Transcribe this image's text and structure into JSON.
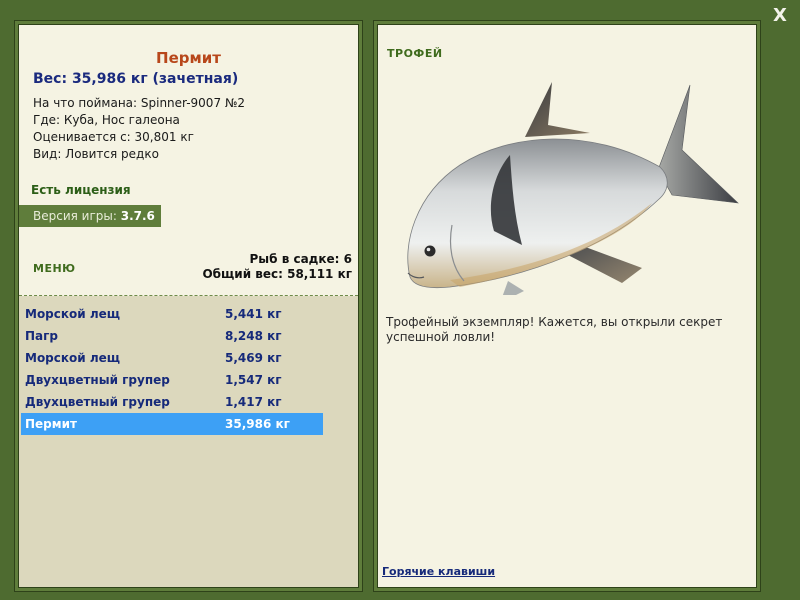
{
  "close_label": "X",
  "fish": {
    "title": "Пермит",
    "weight_line": "Вес: 35,986 кг (зачетная)",
    "info": [
      "На что поймана: Spinner-9007 №2",
      "Где: Куба, Нос галеона",
      "Оценивается с: 30,801 кг",
      "Вид: Ловится редко"
    ]
  },
  "license": "Есть лицензия",
  "version": {
    "label": "Версия игры: ",
    "value": "3.7.6"
  },
  "menu_label": "МЕНЮ",
  "stats": {
    "count": "Рыб в садке: 6",
    "total": "Общий вес: 58,111 кг"
  },
  "catches": [
    {
      "name": "Морской лещ",
      "weight": "5,441 кг"
    },
    {
      "name": "Пагр",
      "weight": "8,248 кг"
    },
    {
      "name": "Морской лещ",
      "weight": "5,469 кг"
    },
    {
      "name": "Двухцветный групер",
      "weight": "1,547 кг"
    },
    {
      "name": "Двухцветный групер",
      "weight": "1,417 кг"
    },
    {
      "name": "Пермит",
      "weight": "35,986 кг"
    }
  ],
  "selected_index": 5,
  "trophy": {
    "label": "ТРОФЕЙ",
    "description": "Трофейный экземпляр! Кажется, вы открыли секрет успешной ловли!"
  },
  "hotkeys_link": "Горячие клавиши",
  "colors": {
    "background": "#4e6b30",
    "panel": "#f5f3e3",
    "selected_row": "#3da0f5",
    "title": "#b8471b",
    "link": "#162a7a"
  }
}
